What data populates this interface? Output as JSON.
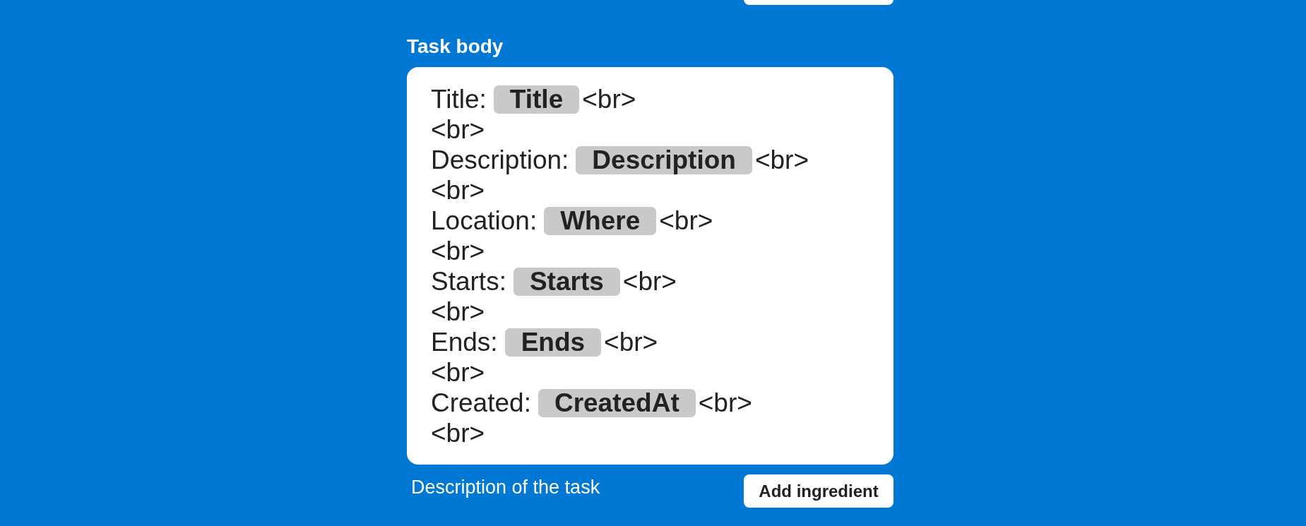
{
  "task_body": {
    "heading": "Task body",
    "lines": [
      {
        "kind": "field",
        "text": "Title:",
        "ingredient": "Title",
        "tail": "<br>"
      },
      {
        "kind": "plain",
        "text": "<br>"
      },
      {
        "kind": "field",
        "text": "Description:",
        "ingredient": "Description",
        "tail": "<br>"
      },
      {
        "kind": "plain",
        "text": "<br>"
      },
      {
        "kind": "field",
        "text": "Location:",
        "ingredient": "Where",
        "tail": "<br>"
      },
      {
        "kind": "plain",
        "text": "<br>"
      },
      {
        "kind": "field",
        "text": "Starts:",
        "ingredient": "Starts",
        "tail": "<br>"
      },
      {
        "kind": "plain",
        "text": "<br>"
      },
      {
        "kind": "field",
        "text": "Ends:",
        "ingredient": "Ends",
        "tail": "<br>"
      },
      {
        "kind": "plain",
        "text": "<br>"
      },
      {
        "kind": "field",
        "text": "Created:",
        "ingredient": "CreatedAt",
        "tail": "<br>"
      },
      {
        "kind": "plain",
        "text": "<br>"
      }
    ],
    "hint": "Description of the task",
    "button": "Add ingredient"
  }
}
